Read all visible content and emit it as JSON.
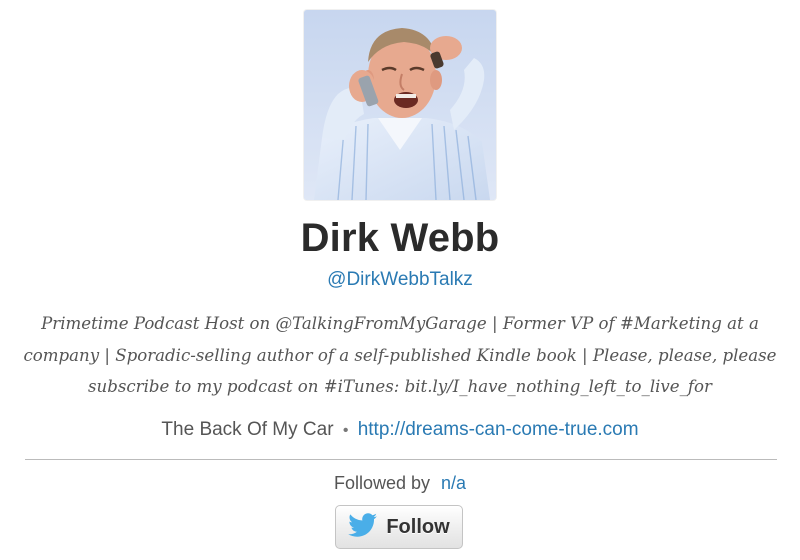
{
  "profile": {
    "avatar_alt": "profile-photo",
    "name": "Dirk Webb",
    "handle": "@DirkWebbTalkz",
    "bio_lines": [
      "Primetime Podcast Host on @TalkingFromMyGarage | Former VP of #Marketing at a",
      "company | Sporadic-selling author of a self-published Kindle book | Please, please, please",
      "subscribe to my podcast on #iTunes: bit.ly/I_have_nothing_left_to_live_for"
    ],
    "location": "The Back Of My Car",
    "separator": "•",
    "website": "http://dreams-can-come-true.com"
  },
  "followers": {
    "label": "Followed by",
    "count": "n/a"
  },
  "follow_button": {
    "label": "Follow",
    "icon": "twitter-bird-icon"
  },
  "colors": {
    "link": "#2a7ab3",
    "name": "#2b2b2b",
    "muted_text": "#555555",
    "divider": "#bbbbbb",
    "twitter_blue": "#4aaee8"
  }
}
